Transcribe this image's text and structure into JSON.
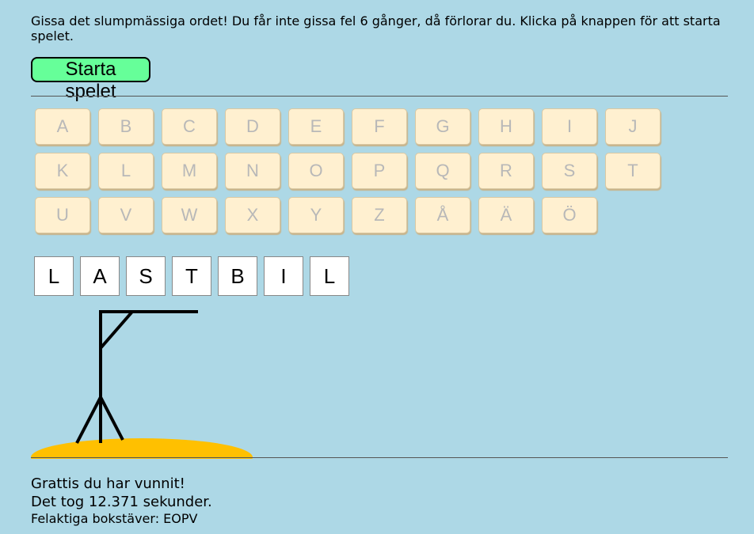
{
  "intro_text": "Gissa det slumpmässiga ordet! Du får inte gissa fel 6 gånger, då förlorar du. Klicka på knappen för att starta spelet.",
  "start_button_label": "Starta spelet",
  "keyboard": {
    "rows": [
      [
        "A",
        "B",
        "C",
        "D",
        "E",
        "F",
        "G",
        "H",
        "I",
        "J"
      ],
      [
        "K",
        "L",
        "M",
        "N",
        "O",
        "P",
        "Q",
        "R",
        "S",
        "T"
      ],
      [
        "U",
        "V",
        "W",
        "X",
        "Y",
        "Z",
        "Å",
        "Ä",
        "Ö"
      ]
    ]
  },
  "word_letters": [
    "L",
    "A",
    "S",
    "T",
    "B",
    "I",
    "L"
  ],
  "result": {
    "win_message": "Grattis du har vunnit!",
    "time_message": "Det tog 12.371 sekunder.",
    "wrong_letters_message": "Felaktiga bokstäver: EOPV"
  },
  "colors": {
    "background": "#add8e6",
    "start_button": "#66ff99",
    "key_background": "#fff0d0",
    "key_text_disabled": "#b8b8b8",
    "hill": "#ffc000"
  }
}
